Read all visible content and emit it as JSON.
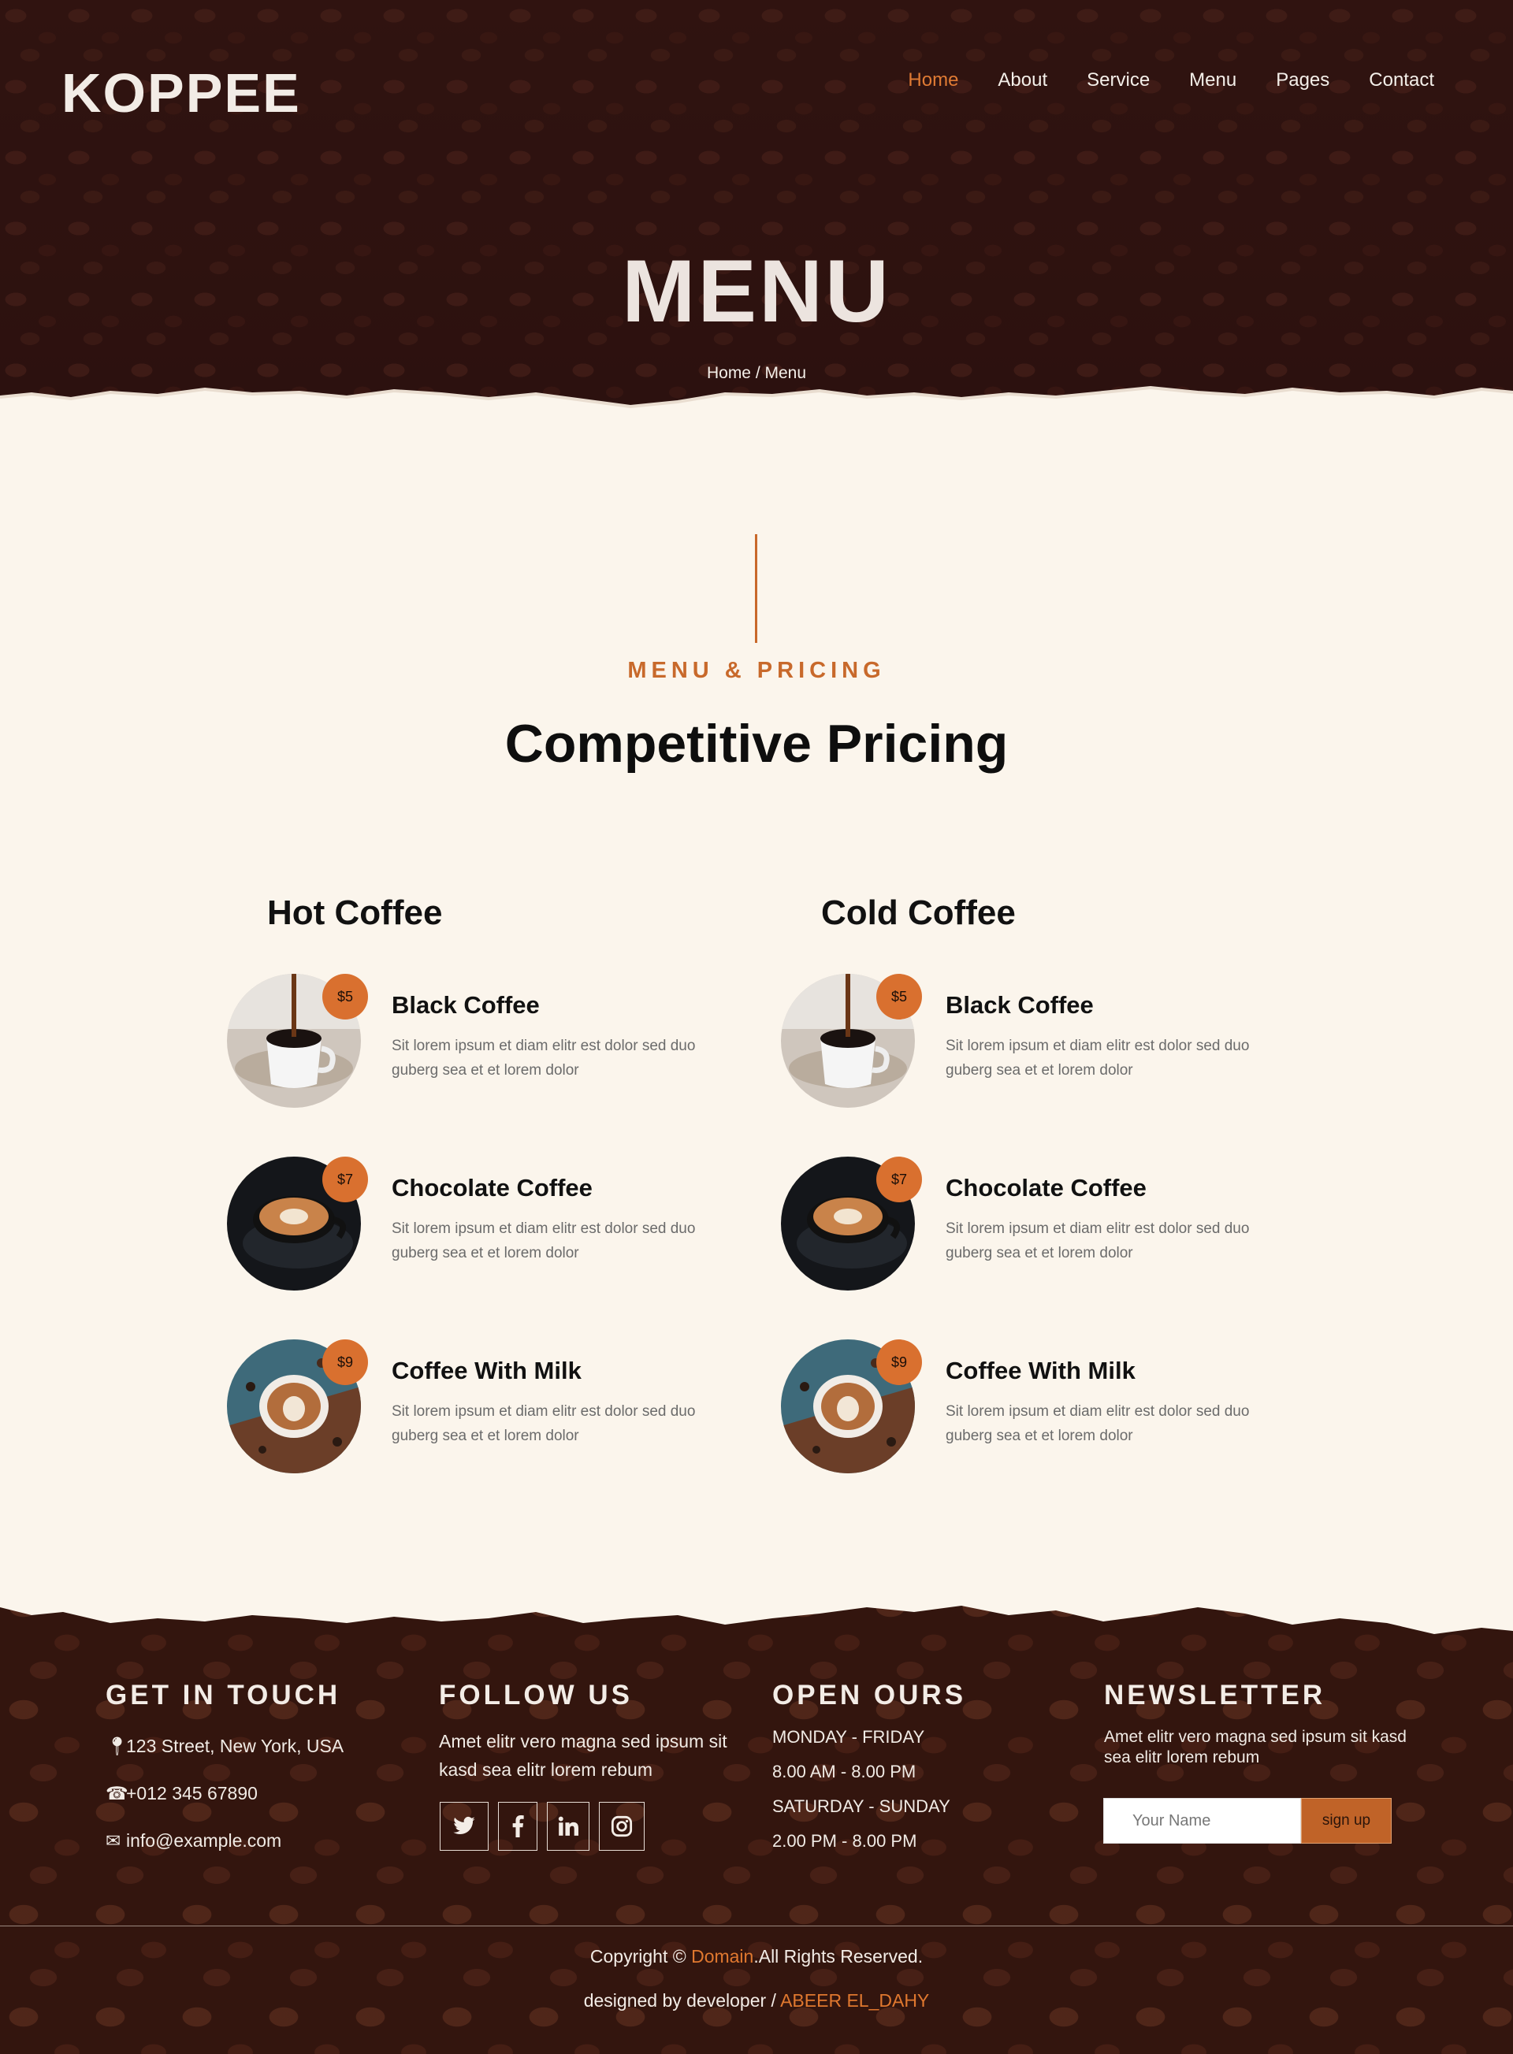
{
  "brand": {
    "logo": "KOPPEE"
  },
  "nav": [
    "Home",
    "About",
    "Service",
    "Menu",
    "Pages",
    "Contact"
  ],
  "hero": {
    "title": "MENU",
    "breadcrumb": "Home / Menu"
  },
  "section": {
    "kicker": "MENU & PRICING",
    "title": "Competitive Pricing"
  },
  "columns": [
    {
      "title": "Hot Coffee",
      "items": [
        {
          "name": "Black Coffee",
          "price": "$5",
          "desc": "Sit lorem ipsum et diam elitr est dolor sed duo guberg sea et et lorem dolor"
        },
        {
          "name": "Chocolate Coffee",
          "price": "$7",
          "desc": "Sit lorem ipsum et diam elitr est dolor sed duo guberg sea et et lorem dolor"
        },
        {
          "name": "Coffee With Milk",
          "price": "$9",
          "desc": "Sit lorem ipsum et diam elitr est dolor sed duo guberg sea et et lorem dolor"
        }
      ]
    },
    {
      "title": "Cold Coffee",
      "items": [
        {
          "name": "Black Coffee",
          "price": "$5",
          "desc": "Sit lorem ipsum et diam elitr est dolor sed duo guberg sea et et lorem dolor"
        },
        {
          "name": "Chocolate Coffee",
          "price": "$7",
          "desc": "Sit lorem ipsum et diam elitr est dolor sed duo guberg sea et et lorem dolor"
        },
        {
          "name": "Coffee With Milk",
          "price": "$9",
          "desc": "Sit lorem ipsum et diam elitr est dolor sed duo guberg sea et et lorem dolor"
        }
      ]
    }
  ],
  "footer": {
    "contact": {
      "heading": "GET IN TOUCH",
      "address": "123 Street, New York, USA",
      "phone": "+012 345 67890",
      "email": "info@example.com"
    },
    "follow": {
      "heading": "FOLLOW US",
      "text": "Amet elitr vero magna sed ipsum sit kasd sea elitr lorem rebum",
      "icons": [
        "twitter-icon",
        "facebook-icon",
        "linkedin-icon",
        "instagram-icon"
      ]
    },
    "hours": {
      "heading": "OPEN OURS",
      "lines": [
        "MONDAY - FRIDAY",
        "8.00 AM - 8.00 PM",
        "SATURDAY - SUNDAY",
        "2.00 PM - 8.00 PM"
      ]
    },
    "newsletter": {
      "heading": "NEWSLETTER",
      "text": "Amet elitr vero magna sed ipsum sit kasd sea elitr lorem rebum",
      "placeholder": "Your Name",
      "button": "sign up"
    },
    "copyright": {
      "prefix": "Copyright © ",
      "link": "Domain",
      "suffix": ".All Rights Reserved."
    },
    "credit": {
      "prefix": "designed by developer / ",
      "link": "ABEER EL_DAHY"
    }
  },
  "colors": {
    "accent": "#d9702f",
    "hero_bg": "#3a1a15",
    "page_bg": "#fbf5ec"
  }
}
